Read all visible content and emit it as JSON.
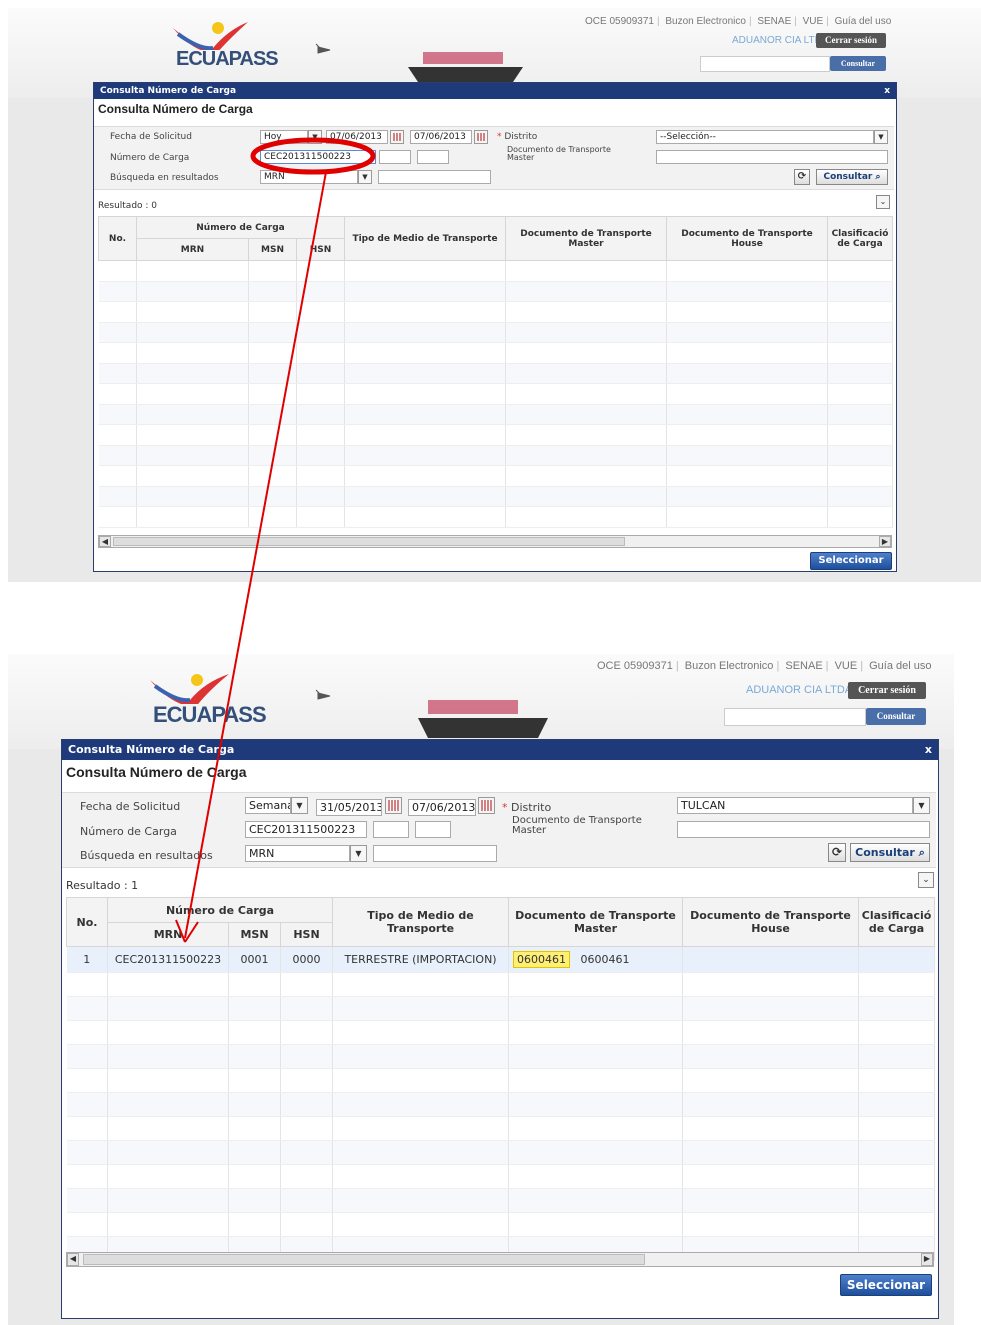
{
  "header": {
    "logo": "ECUAPASS",
    "links": [
      "OCE 05909371",
      "Buzon Electronico",
      "SENAE",
      "VUE",
      "Guía del uso"
    ],
    "company": "ADUANOR CIA LTDA",
    "logout_label": "Cerrar sesión",
    "consult_label": "Consultar"
  },
  "dialog": {
    "window_title": "Consulta Número de Carga",
    "heading": "Consulta Número de Carga",
    "close_label": "x",
    "labels": {
      "fecha": "Fecha de Solicitud",
      "numero": "Número de Carga",
      "busqueda": "Búsqueda en resultados",
      "distrito": "Distrito",
      "documento": "Documento de Transporte Master",
      "required": "*"
    },
    "consult_button": "Consultar",
    "select_button": "Seleccionar",
    "columns": {
      "no": "No.",
      "numero_carga": "Número de Carga",
      "mrn": "MRN",
      "msn": "MSN",
      "hsn": "HSN",
      "tipo": "Tipo de Medio de Transporte",
      "doc_master": "Documento de Transporte Master",
      "doc_house": "Documento de Transporte House",
      "clasif": "Clasificació de Carga"
    }
  },
  "top": {
    "fecha_period": "Hoy",
    "fecha_from": "07/06/2013",
    "fecha_to": "07/06/2013",
    "numero_carga": "CEC201311500223",
    "busqueda": "MRN",
    "distrito": "--Selección--",
    "result": "Resultado : 0"
  },
  "bottom": {
    "fecha_period": "Semana",
    "fecha_from": "31/05/2013",
    "fecha_to": "07/06/2013",
    "numero_carga": "CEC201311500223",
    "busqueda": "MRN",
    "distrito": "TULCAN",
    "result": "Resultado : 1",
    "row": {
      "no": "1",
      "mrn": "CEC201311500223",
      "msn": "0001",
      "hsn": "0000",
      "tipo": "TERRESTRE (IMPORTACION)",
      "doc_master_a": "0600461",
      "doc_master_b": "0600461",
      "doc_house": "",
      "clasif": ""
    }
  },
  "colors": {
    "dialog_title_bg": "#1f3a7a",
    "annotation_red": "#e00000",
    "highlight": "#ffef75"
  }
}
